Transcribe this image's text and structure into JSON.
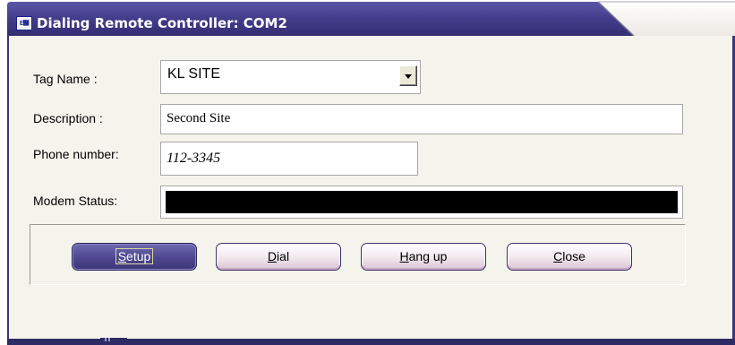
{
  "window": {
    "title": "Dialing Remote Controller: COM2"
  },
  "form": {
    "tag_name_label": "Tag Name :",
    "tag_name_value": "KL SITE",
    "description_label": "Description :",
    "description_value": "Second Site",
    "phone_label": "Phone number:",
    "phone_value": "112-3345",
    "modem_status_label": "Modem Status:",
    "modem_status_value": ""
  },
  "buttons": {
    "setup": {
      "mnemonic": "S",
      "rest": "etup"
    },
    "dial": {
      "mnemonic": "D",
      "rest": "ial"
    },
    "hangup": {
      "mnemonic": "H",
      "rest": "ang up"
    },
    "close": {
      "mnemonic": "C",
      "rest": "lose"
    }
  },
  "colors": {
    "titlebar": "#453e8d",
    "client_bg": "#f5f4ec",
    "primary_button": "#4e478f"
  },
  "icons": {
    "app": "app-icon",
    "dropdown": "chevron-down-icon"
  }
}
